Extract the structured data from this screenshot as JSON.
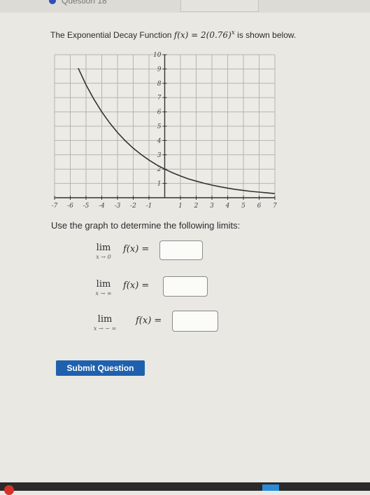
{
  "header": {
    "tab_label": "Question 18"
  },
  "question": {
    "prefix": "The Exponential Decay Function ",
    "fx": "f(x)",
    "equals": " = ",
    "base": "2(0.76)",
    "exponent": "x",
    "suffix": " is shown below."
  },
  "chart_data": {
    "type": "line",
    "function": "f(x) = 2(0.76)^x",
    "series": [
      {
        "points": [
          [
            -5.5,
            9.06
          ],
          [
            -5,
            7.89
          ],
          [
            -4.5,
            6.88
          ],
          [
            -4,
            6.0
          ],
          [
            -3.5,
            5.23
          ],
          [
            -3,
            4.56
          ],
          [
            -2.5,
            3.97
          ],
          [
            -2,
            3.46
          ],
          [
            -1.5,
            3.02
          ],
          [
            -1,
            2.63
          ],
          [
            -0.5,
            2.29
          ],
          [
            0,
            2.0
          ],
          [
            0.5,
            1.74
          ],
          [
            1,
            1.52
          ],
          [
            1.5,
            1.32
          ],
          [
            2,
            1.16
          ],
          [
            2.5,
            1.01
          ],
          [
            3,
            0.88
          ],
          [
            3.5,
            0.77
          ],
          [
            4,
            0.67
          ],
          [
            4.5,
            0.58
          ],
          [
            5,
            0.51
          ],
          [
            5.5,
            0.44
          ],
          [
            6,
            0.39
          ],
          [
            6.5,
            0.34
          ],
          [
            7,
            0.29
          ]
        ]
      }
    ],
    "xlim": [
      -7,
      7
    ],
    "ylim": [
      0,
      10
    ],
    "x_ticks": [
      "-7",
      "-6",
      "-5",
      "-4",
      "-3",
      "-2",
      "-1",
      "1",
      "2",
      "3",
      "4",
      "5",
      "6",
      "7"
    ],
    "y_ticks": [
      "1",
      "2",
      "3",
      "4",
      "5",
      "6",
      "7",
      "8",
      "9",
      "10"
    ],
    "grid": true
  },
  "instructions": "Use the graph to determine the following limits:",
  "limits": [
    {
      "lim": "lim",
      "sub": "x → 0",
      "expr": "f(x) ="
    },
    {
      "lim": "lim",
      "sub": "x → ∞",
      "expr": "f(x) ="
    },
    {
      "lim": "lim",
      "sub": "x → − ∞",
      "expr": "f(x) ="
    }
  ],
  "submit_label": "Submit Question",
  "colors": {
    "submit_bg": "#1f61ad",
    "curve": "#333333",
    "grid": "#b5b4ae"
  }
}
